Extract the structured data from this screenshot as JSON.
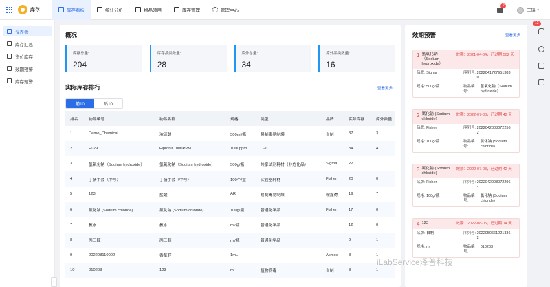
{
  "header": {
    "app_title": "库存",
    "nav": [
      {
        "label": "库存看板",
        "icon": "dashboard-icon",
        "active": true
      },
      {
        "label": "统计分析",
        "icon": "chart-icon",
        "active": false
      },
      {
        "label": "物品领用",
        "icon": "box-icon",
        "active": false
      },
      {
        "label": "库存管理",
        "icon": "folder-icon",
        "active": false
      },
      {
        "label": "管理中心",
        "icon": "gear-icon",
        "active": false
      }
    ],
    "notification_count": "2",
    "user_name": "王瑞"
  },
  "sidebar": {
    "items": [
      {
        "label": "仪表盘",
        "active": true
      },
      {
        "label": "库存汇总",
        "active": false
      },
      {
        "label": "货位库存",
        "active": false
      },
      {
        "label": "效期预警",
        "active": false
      },
      {
        "label": "库存预警",
        "active": false
      }
    ]
  },
  "overview": {
    "title": "概况",
    "cards": [
      {
        "label": "库存总量:",
        "value": "204"
      },
      {
        "label": "库存品类数量:",
        "value": "28"
      },
      {
        "label": "库外总量:",
        "value": "34"
      },
      {
        "label": "库外品类数量:",
        "value": "16"
      }
    ]
  },
  "ranking": {
    "title": "实际库存排行",
    "more_label": "查看更多",
    "tabs": [
      "前10",
      "后10"
    ],
    "columns": [
      "排名",
      "物品编号",
      "物品名称",
      "规格",
      "类型",
      "品牌",
      "实际库存",
      "库外数量"
    ],
    "rows": [
      [
        "1",
        "Demo_Chemical",
        "浓硫酸",
        "500ml/瓶",
        "易制毒易制爆",
        "自制",
        "37",
        "3"
      ],
      [
        "2",
        "F029",
        "Fipronil 1000PPM",
        "1000ppm",
        "D-1",
        "",
        "34",
        "4"
      ],
      [
        "3",
        "氢氧化钠（Sodium hydroxide）",
        "氢氧化钠（Sodium hydroxide）",
        "500g/瓶",
        "共享试剂耗材（非危化品）",
        "Sigma",
        "22",
        "1"
      ],
      [
        "4",
        "丁腈手套（中号）",
        "丁腈手套（中号）",
        "100个/盒",
        "实验室耗材",
        "Fisher",
        "20",
        "0"
      ],
      [
        "5",
        "123",
        "盐酸",
        "AR",
        "易制毒易制爆",
        "鞍鑫得",
        "19",
        "7"
      ],
      [
        "6",
        "氯化钠 (Sodium chloride)",
        "氯化钠 (Sodium chloride)",
        "100g/瓶",
        "普通化学品",
        "Fisher",
        "17",
        "0"
      ],
      [
        "7",
        "氨水",
        "氨水",
        "ml/瓶",
        "普通化学品",
        "",
        "12",
        "0"
      ],
      [
        "8",
        "丙三醇",
        "丙三醇",
        "ml/瓶",
        "普通化学品",
        "",
        "9",
        "1"
      ],
      [
        "9",
        "202208110002",
        "香草醛",
        "1mL",
        "",
        "Acmec",
        "8",
        "1"
      ],
      [
        "10",
        "010203",
        "123",
        "ml",
        "植物病毒",
        "自制",
        "8",
        "1"
      ]
    ]
  },
  "expiry": {
    "title": "效期预警",
    "more_label": "查看更多",
    "labels": {
      "brand": "品牌:",
      "serial": "序列号:",
      "spec": "规格:",
      "item_no": "物品编号:"
    },
    "items": [
      {
        "num": "1",
        "name": "氢氧化钠（Sodium hydroxide）",
        "date": "效期：2021-04-04，已过期 502 天",
        "brand": "Sigma",
        "serial": "20220417279513830",
        "spec": "500g/瓶",
        "item_no": "氢氧化钠（Sodium hydroxide）"
      },
      {
        "num": "2",
        "name": "氯化钠 (Sodium chloride)",
        "date": "效期：2022-07-08，已过期 42 天",
        "brand": "Fisher",
        "serial": "20220420080722562",
        "spec": "100g/瓶",
        "item_no": "氯化钠 (Sodium chloride)"
      },
      {
        "num": "3",
        "name": "氯化钠 (Sodium chloride)",
        "date": "效期：2022-07-08，已过期 42 天",
        "brand": "Fisher",
        "serial": "20220420080722964",
        "spec": "100g/瓶",
        "item_no": "氯化钠 (Sodium chloride)"
      },
      {
        "num": "4",
        "name": "123",
        "date": "效期：2022-08-05，已过期 14 天",
        "brand": "自制",
        "serial": "20220506612213362",
        "spec": "ml",
        "item_no": "010203"
      }
    ]
  },
  "right_strip": {
    "badge": "12"
  },
  "watermark": "iLabService泽普科技"
}
